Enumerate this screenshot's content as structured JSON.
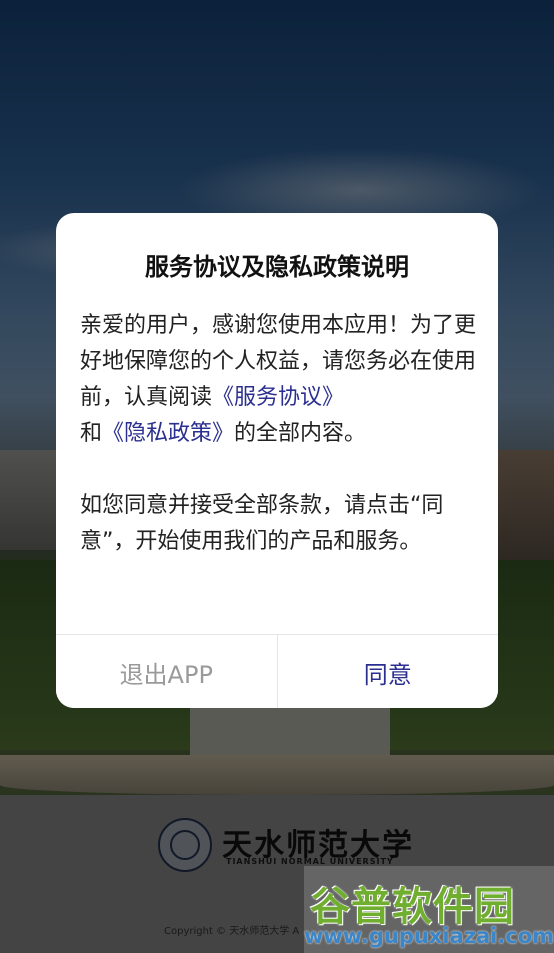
{
  "dialog": {
    "title": "服务协议及隐私政策说明",
    "para1_part1": "亲爱的用户，感谢您使用本应用！为了更好地保障您的个人权益，请您务必在使用前，认真阅读",
    "service_link": "《服务协议》",
    "para1_and": "和",
    "privacy_link": "《隐私政策》",
    "para1_part2": "的全部内容。",
    "para2": "如您同意并接受全部条款，请点击“同意”，开始使用我们的产品和服务。",
    "exit_label": "退出APP",
    "agree_label": "同意"
  },
  "footer": {
    "university_name": "天水师范大学",
    "university_en": "TIANSHUI NORMAL UNIVERSITY",
    "copyright": "Copyright © 天水师范大学 A"
  },
  "watermark": {
    "name": "谷普软件园",
    "url": "www.gupuxiazai.com"
  },
  "colors": {
    "link": "#2b2f8f",
    "agree": "#2b2f8f",
    "exit": "#9a9a9a"
  }
}
